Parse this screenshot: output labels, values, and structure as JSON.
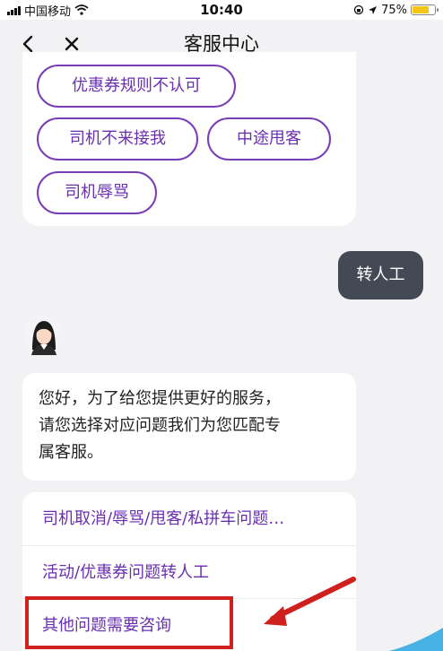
{
  "status_bar": {
    "carrier": "中国移动",
    "time": "10:40",
    "battery": "75%",
    "battery_level": 0.75
  },
  "nav": {
    "title": "客服中心"
  },
  "top_options": [
    "优惠券规则不认可",
    "司机不来接我",
    "中途甩客",
    "司机辱骂"
  ],
  "user_message": "转人工",
  "agent_message": {
    "line1": "您好，为了给您提供更好的服务，",
    "line2": "请您选择对应问题我们为您匹配专",
    "line3": "属客服。"
  },
  "menu_options": [
    "司机取消/辱骂/甩客/私拼车问题…",
    "活动/优惠券问题转人工",
    "其他问题需要咨询"
  ],
  "colors": {
    "accent": "#6a2fb0",
    "user_bubble": "#444a55",
    "highlight": "#d0201e"
  }
}
